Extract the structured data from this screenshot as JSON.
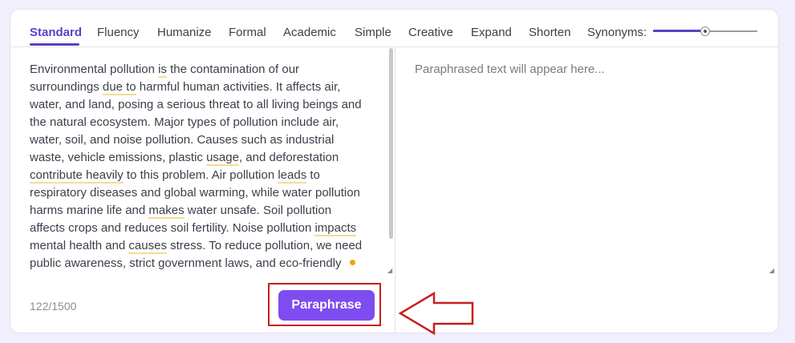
{
  "tabs": [
    {
      "label": "Standard",
      "active": true
    },
    {
      "label": "Fluency"
    },
    {
      "label": "Humanize"
    },
    {
      "label": "Formal"
    },
    {
      "label": "Academic"
    },
    {
      "label": "Simple"
    },
    {
      "label": "Creative"
    },
    {
      "label": "Expand"
    },
    {
      "label": "Shorten"
    }
  ],
  "synonyms": {
    "label": "Synonyms:",
    "level": 0.5
  },
  "input": {
    "lines": [
      [
        {
          "t": "Environmental pollution "
        },
        {
          "t": "is",
          "h": true
        },
        {
          "t": " the contamination of our"
        }
      ],
      [
        {
          "t": "surroundings "
        },
        {
          "t": "due to",
          "h": true
        },
        {
          "t": " harmful human activities. It affects air,"
        }
      ],
      [
        {
          "t": "water, and land, posing a serious threat to all living beings and"
        }
      ],
      [
        {
          "t": "the natural ecosystem. Major types of pollution include air,"
        }
      ],
      [
        {
          "t": "water, soil, and noise pollution. Causes such as industrial"
        }
      ],
      [
        {
          "t": "waste, vehicle emissions, plastic "
        },
        {
          "t": "usage",
          "h": true
        },
        {
          "t": ", and deforestation"
        }
      ],
      [
        {
          "t": "contribute heavily",
          "h": true
        },
        {
          "t": " to this problem. Air pollution "
        },
        {
          "t": "leads",
          "h": true
        },
        {
          "t": " to"
        }
      ],
      [
        {
          "t": "respiratory diseases and global warming, while water pollution"
        }
      ],
      [
        {
          "t": "harms marine life and "
        },
        {
          "t": "makes",
          "h": true
        },
        {
          "t": " water unsafe. Soil pollution"
        }
      ],
      [
        {
          "t": "affects crops and reduces soil fertility. Noise pollution "
        },
        {
          "t": "impacts",
          "h": true
        }
      ],
      [
        {
          "t": "mental health and "
        },
        {
          "t": "causes",
          "h": true
        },
        {
          "t": " stress. To reduce pollution, we need"
        }
      ],
      [
        {
          "t": "public awareness, strict government laws, and eco-friendly"
        }
      ]
    ]
  },
  "output": {
    "placeholder": "Paraphrased text will appear here..."
  },
  "counter": "122/1500",
  "paraphrase_button": "Paraphrase",
  "colors": {
    "accent": "#5b3fc4",
    "button": "#7f4cf0",
    "annotation": "#c81e1e"
  }
}
